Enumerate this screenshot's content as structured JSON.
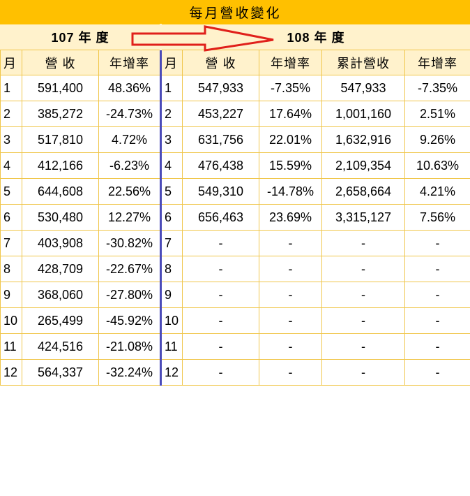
{
  "title": "每月營收變化",
  "year_labels": {
    "y107": "107 年 度",
    "y108": "108 年 度"
  },
  "headers": [
    "月",
    "營 收",
    "年增率",
    "月",
    "營 收",
    "年增率",
    "累計營收",
    "年增率"
  ],
  "rows": [
    [
      "1",
      "591,400",
      "48.36%",
      "1",
      "547,933",
      "-7.35%",
      "547,933",
      "-7.35%"
    ],
    [
      "2",
      "385,272",
      "-24.73%",
      "2",
      "453,227",
      "17.64%",
      "1,001,160",
      "2.51%"
    ],
    [
      "3",
      "517,810",
      "4.72%",
      "3",
      "631,756",
      "22.01%",
      "1,632,916",
      "9.26%"
    ],
    [
      "4",
      "412,166",
      "-6.23%",
      "4",
      "476,438",
      "15.59%",
      "2,109,354",
      "10.63%"
    ],
    [
      "5",
      "644,608",
      "22.56%",
      "5",
      "549,310",
      "-14.78%",
      "2,658,664",
      "4.21%"
    ],
    [
      "6",
      "530,480",
      "12.27%",
      "6",
      "656,463",
      "23.69%",
      "3,315,127",
      "7.56%"
    ],
    [
      "7",
      "403,908",
      "-30.82%",
      "7",
      "-",
      "-",
      "-",
      "-"
    ],
    [
      "8",
      "428,709",
      "-22.67%",
      "8",
      "-",
      "-",
      "-",
      "-"
    ],
    [
      "9",
      "368,060",
      "-27.80%",
      "9",
      "-",
      "-",
      "-",
      "-"
    ],
    [
      "10",
      "265,499",
      "-45.92%",
      "10",
      "-",
      "-",
      "-",
      "-"
    ],
    [
      "11",
      "424,516",
      "-21.08%",
      "11",
      "-",
      "-",
      "-",
      "-"
    ],
    [
      "12",
      "564,337",
      "-32.24%",
      "12",
      "-",
      "-",
      "-",
      "-"
    ]
  ],
  "colors": {
    "title_bg": "#ffc000",
    "header_bg": "#fff2cc",
    "grid": "#f0c64a",
    "divider": "#4b4bb8",
    "arrow": "#e0201a"
  },
  "icons": {
    "arrow": "right-arrow-outline-icon"
  }
}
